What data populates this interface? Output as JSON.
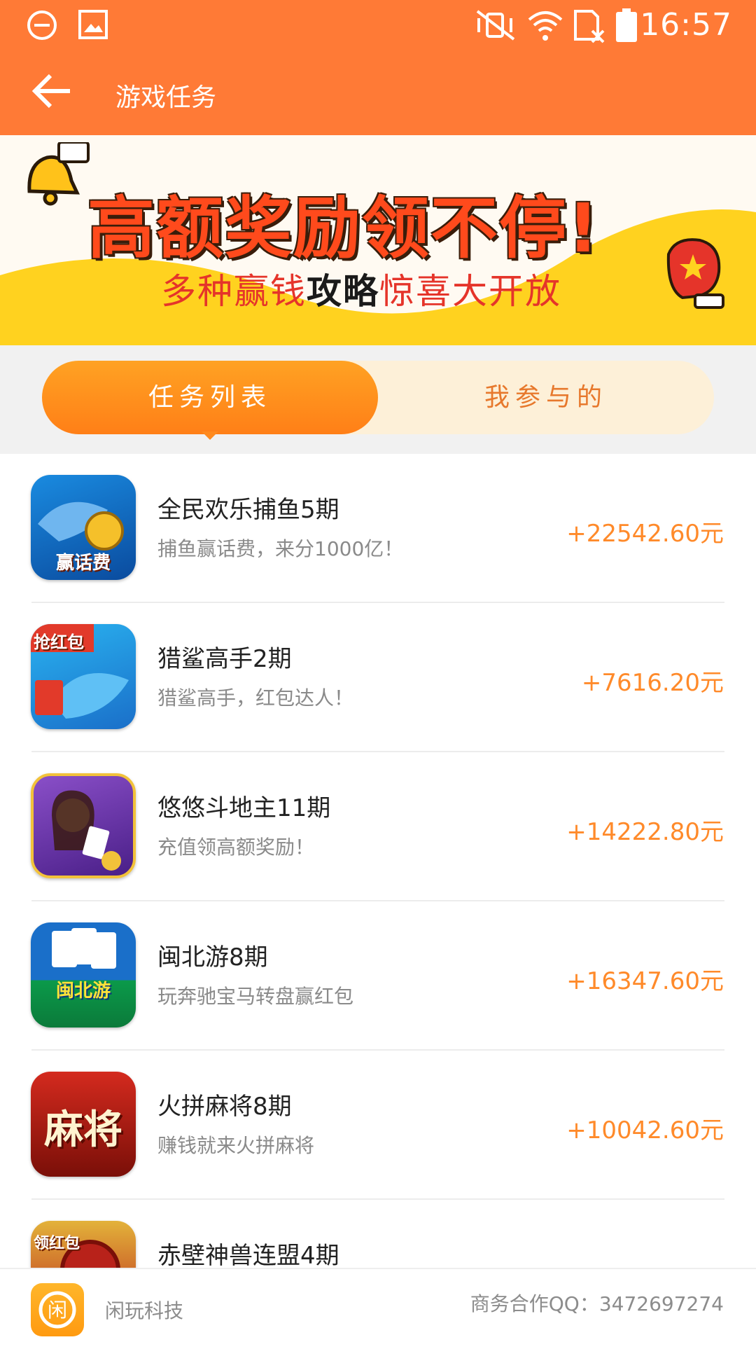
{
  "status_bar": {
    "time": "16:57",
    "icons": [
      "minus-circle-icon",
      "image-icon",
      "mute-vibrate-icon",
      "wifi-icon",
      "no-sim-icon",
      "battery-icon"
    ]
  },
  "header": {
    "title": "游戏任务",
    "back_icon": "back-arrow-icon",
    "background": "#ff7a36"
  },
  "banner": {
    "headline": "高额奖励领不停!",
    "subtitle_part1": "多种赢钱",
    "subtitle_part2": "攻略",
    "subtitle_part3": "惊喜大开放",
    "icons": [
      "bell-icon",
      "boxing-glove-icon"
    ]
  },
  "tabs": [
    {
      "label": "任务列表",
      "active": true
    },
    {
      "label": "我参与的",
      "active": false
    }
  ],
  "tasks": [
    {
      "name": "全民欢乐捕鱼5期",
      "desc": "捕鱼赢话费，来分1000亿！",
      "amount": "+22542.60元",
      "icon_text": "赢话费",
      "icon_colors": [
        "#1a8be0",
        "#0a4b9e"
      ]
    },
    {
      "name": "猎鲨高手2期",
      "desc": "猎鲨高手，红包达人！",
      "amount": "+7616.20元",
      "icon_text": "抢红包",
      "icon_colors": [
        "#2ab3f0",
        "#e23a2a"
      ]
    },
    {
      "name": "悠悠斗地主11期",
      "desc": "充值领高额奖励！",
      "amount": "+14222.80元",
      "icon_text": "",
      "icon_colors": [
        "#7a3fb8",
        "#f2c23a"
      ]
    },
    {
      "name": "闽北游8期",
      "desc": "玩奔驰宝马转盘赢红包",
      "amount": "+16347.60元",
      "icon_text": "闽北游",
      "icon_colors": [
        "#1a6fc9",
        "#0b9a4a"
      ]
    },
    {
      "name": "火拼麻将8期",
      "desc": "赚钱就来火拼麻将",
      "amount": "+10042.60元",
      "icon_text": "麻将",
      "icon_colors": [
        "#d42a1e",
        "#7a0f08"
      ]
    },
    {
      "name": "赤壁神兽连盟4期",
      "desc": "",
      "amount": "",
      "icon_text": "领红包",
      "icon_colors": [
        "#b8221a",
        "#e3b23a"
      ]
    }
  ],
  "footer": {
    "company": "闲玩科技",
    "contact": "商务合作QQ：3472697274",
    "logo_text": "闲"
  }
}
